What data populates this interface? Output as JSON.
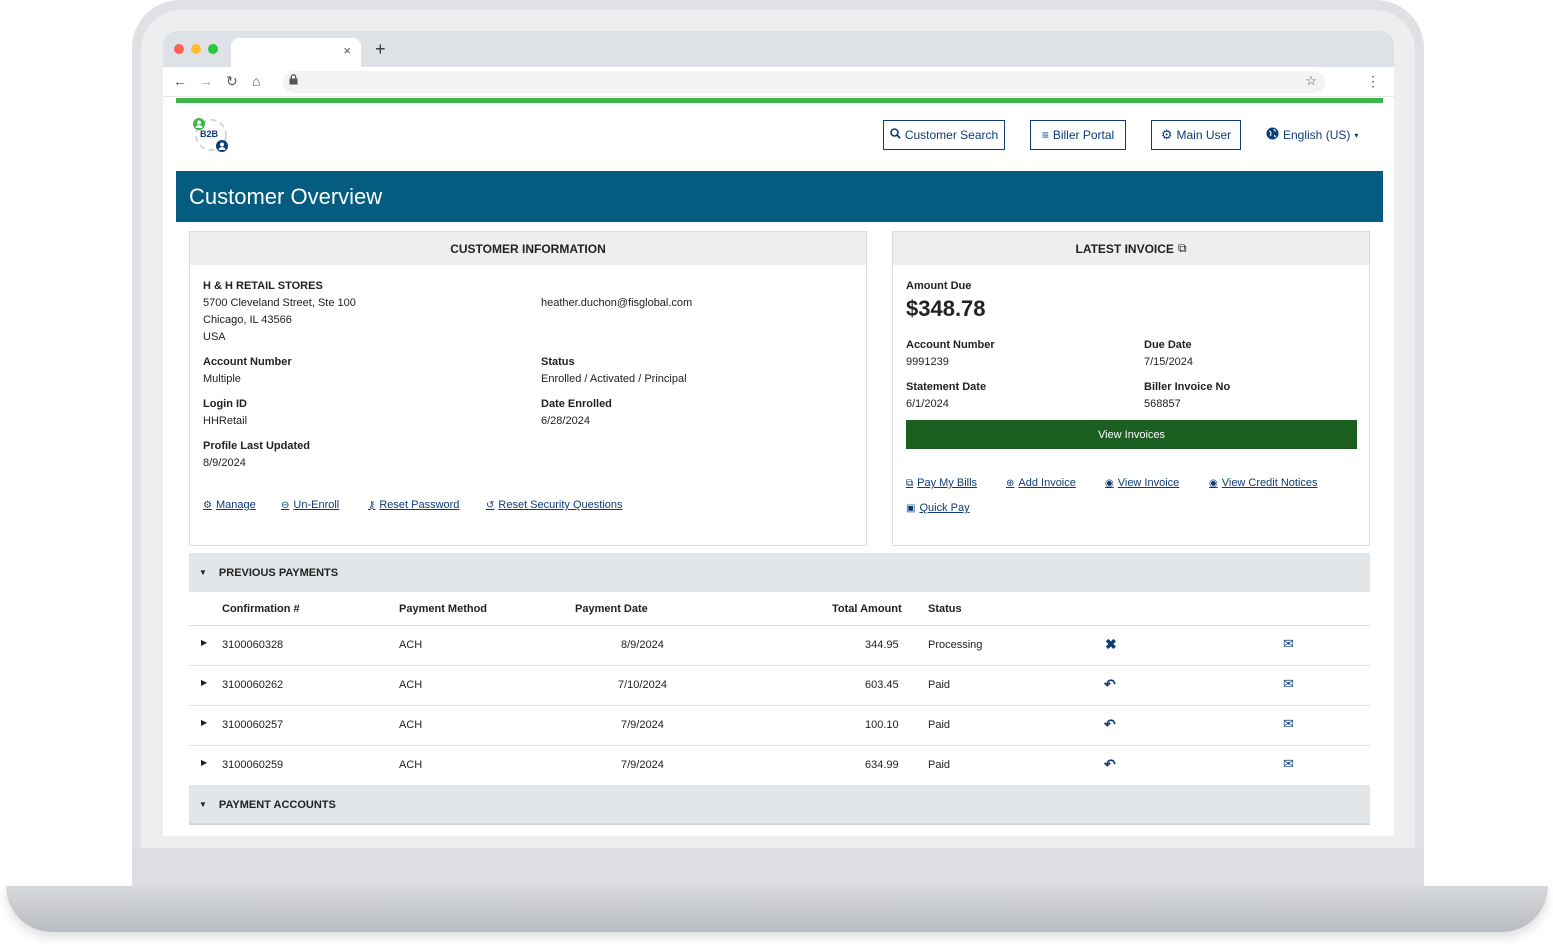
{
  "browser": {
    "tab_close": "×",
    "new_tab": "+"
  },
  "header": {
    "logo_text": "B2B",
    "customer_search": "Customer Search",
    "biller_portal": "Biller Portal",
    "main_user": "Main User",
    "language": "English (US)"
  },
  "page_title": "Customer Overview",
  "customer_info": {
    "heading": "CUSTOMER INFORMATION",
    "name": "H & H RETAIL STORES",
    "address1": "5700 Cleveland Street, Ste 100",
    "address2": "Chicago, IL 43566",
    "country": "USA",
    "email": "heather.duchon@fisglobal.com",
    "account_number_label": "Account Number",
    "account_number": "Multiple",
    "status_label": "Status",
    "status": "Enrolled / Activated / Principal",
    "login_id_label": "Login ID",
    "login_id": "HHRetail",
    "date_enrolled_label": "Date Enrolled",
    "date_enrolled": "6/28/2024",
    "profile_updated_label": "Profile Last Updated",
    "profile_updated": "8/9/2024",
    "links": {
      "manage": "Manage",
      "unenroll": "Un-Enroll",
      "reset_password": "Reset Password",
      "reset_security": "Reset Security Questions"
    }
  },
  "latest_invoice": {
    "heading": "LATEST INVOICE",
    "amount_due_label": "Amount Due",
    "amount_due": "$348.78",
    "account_number_label": "Account Number",
    "account_number": "9991239",
    "due_date_label": "Due Date",
    "due_date": "7/15/2024",
    "statement_date_label": "Statement Date",
    "statement_date": "6/1/2024",
    "biller_invoice_label": "Biller Invoice No",
    "biller_invoice": "568857",
    "view_invoices": "View Invoices",
    "links": {
      "pay_my_bills": "Pay My Bills",
      "add_invoice": "Add Invoice",
      "view_invoice": "View Invoice",
      "view_credit_notices": "View Credit Notices",
      "quick_pay": "Quick Pay"
    }
  },
  "previous_payments": {
    "heading": "PREVIOUS PAYMENTS",
    "columns": [
      "Confirmation #",
      "Payment Method",
      "Payment Date",
      "Total Amount",
      "Status"
    ],
    "rows": [
      {
        "conf": "3100060328",
        "method": "ACH",
        "date": "8/9/2024",
        "amount": "344.95",
        "status": "Processing",
        "action": "cancel-icon"
      },
      {
        "conf": "3100060262",
        "method": "ACH",
        "date": "7/10/2024",
        "amount": "603.45",
        "status": "Paid",
        "action": "reverse-icon"
      },
      {
        "conf": "3100060257",
        "method": "ACH",
        "date": "7/9/2024",
        "amount": "100.10",
        "status": "Paid",
        "action": "reverse-icon"
      },
      {
        "conf": "3100060259",
        "method": "ACH",
        "date": "7/9/2024",
        "amount": "634.99",
        "status": "Paid",
        "action": "reverse-icon"
      }
    ]
  },
  "payment_accounts": {
    "heading": "PAYMENT ACCOUNTS"
  },
  "colors": {
    "title_bar": "#045c80",
    "accent_green": "#3eb549",
    "button_green": "#1b5e20",
    "link_blue": "#0d3d78"
  }
}
